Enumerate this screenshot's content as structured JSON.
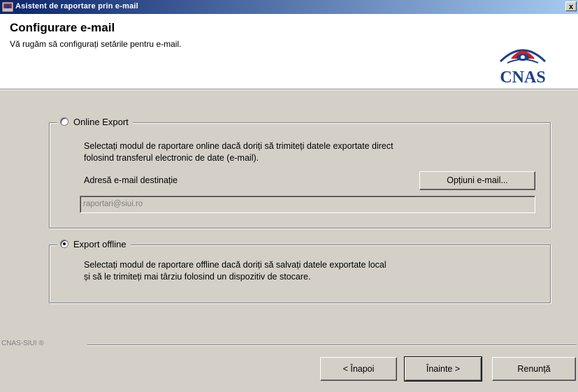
{
  "window": {
    "title": "Asistent de raportare prin e-mail",
    "close": "x"
  },
  "header": {
    "title": "Configurare e-mail",
    "subtitle": "Vă rugăm să configurați setările pentru e-mail.",
    "logo_text": "CNAS"
  },
  "online": {
    "label": "Online Export",
    "selected": false,
    "desc_line1": "Selectați modul de raportare online dacă doriți să trimiteți datele exportate direct",
    "desc_line2": "folosind transferul electronic de date (e-mail).",
    "dest_label": "Adresă e-mail destinație",
    "options_button": "Opțiuni e-mail...",
    "email_value": "raportari@siui.ro"
  },
  "offline": {
    "label": "Export offline",
    "selected": true,
    "desc_line1": "Selectați modul de raportare offline dacă doriți să salvați datele exportate local",
    "desc_line2": "și să le trimiteți mai târziu folosind un dispozitiv de stocare."
  },
  "footer": {
    "brand": "CNAS-SIUI ®",
    "back": "< Înapoi",
    "next": "Înainte >",
    "cancel": "Renunță"
  },
  "colors": {
    "titlebar_start": "#0a246a",
    "titlebar_end": "#a6caf0",
    "face": "#d4d0c8",
    "logo_red": "#cc2222",
    "logo_blue": "#1c3f8c"
  }
}
